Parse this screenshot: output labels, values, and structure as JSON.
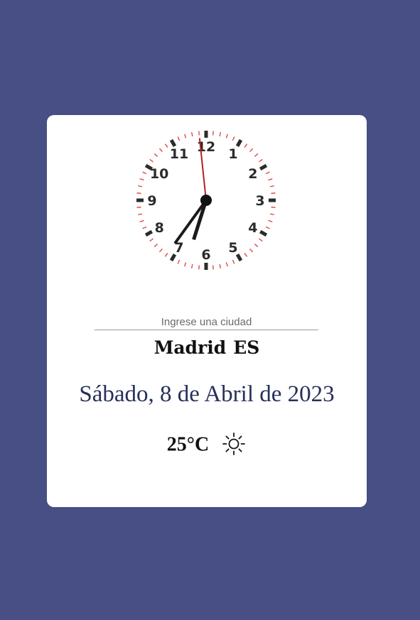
{
  "clock": {
    "numerals": [
      "12",
      "1",
      "2",
      "3",
      "4",
      "5",
      "6",
      "7",
      "8",
      "9",
      "10",
      "11"
    ],
    "time": {
      "hours": 6,
      "minutes": 35,
      "seconds": 59
    },
    "colors": {
      "major_tick": "#2b2b2b",
      "minor_tick": "#e04a4a",
      "hand": "#1a1a1a",
      "second_hand": "#b22222"
    }
  },
  "search": {
    "placeholder": "Ingrese una ciudad",
    "value": ""
  },
  "location": {
    "city": "Madrid",
    "country": "ES"
  },
  "date": {
    "text": "Sábado, 8 de Abril de 2023"
  },
  "weather": {
    "temperature": "25°C",
    "icon": "sun-icon"
  },
  "colors": {
    "background": "#474f84",
    "card": "#ffffff",
    "date_text": "#27305a"
  }
}
